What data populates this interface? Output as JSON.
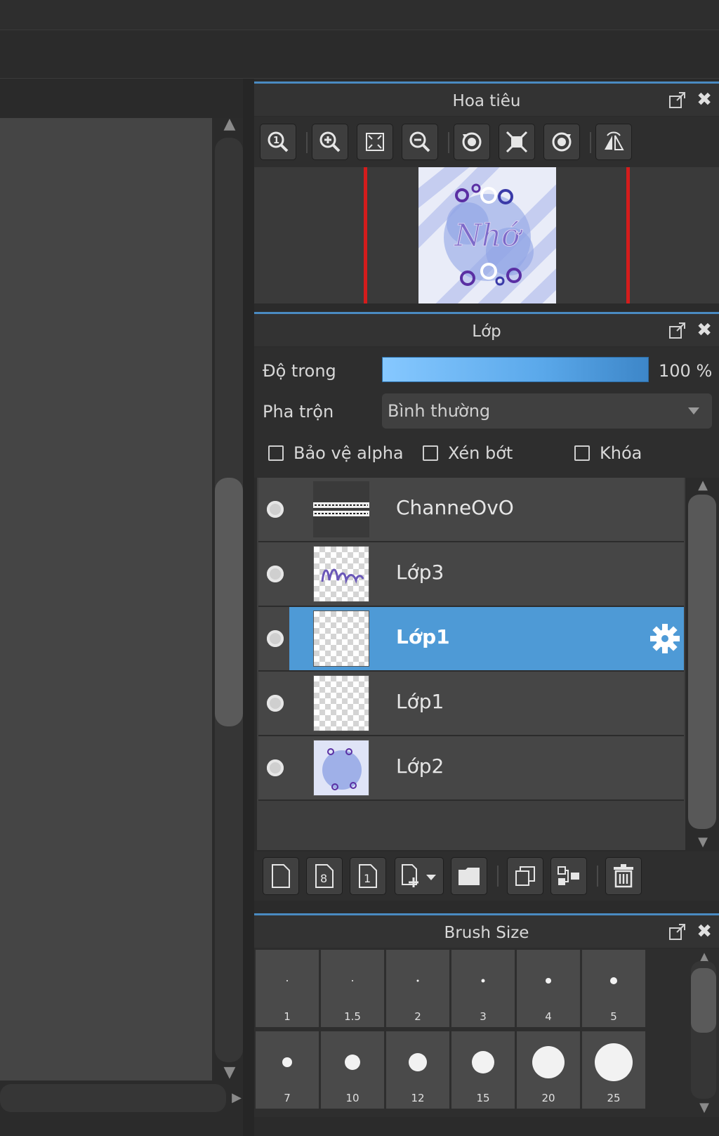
{
  "navigator": {
    "title": "Hoa tiêu",
    "toolbar_icons": [
      "zoom-actual-icon",
      "zoom-in-icon",
      "fit-screen-icon",
      "zoom-out-icon",
      "rotate-left-icon",
      "fit-window-icon",
      "rotate-right-icon",
      "flip-horizontal-icon"
    ],
    "preview_text": "Nhớ"
  },
  "layers": {
    "title": "Lớp",
    "opacity_label": "Độ trong",
    "opacity_value": "100 %",
    "opacity_fraction": 1.0,
    "blend_label": "Pha trộn",
    "blend_value": "Bình thường",
    "checkboxes": [
      {
        "label": "Bảo vệ alpha",
        "checked": false
      },
      {
        "label": "Xén bớt",
        "checked": false
      },
      {
        "label": "Khóa",
        "checked": false
      }
    ],
    "items": [
      {
        "name": "ChanneOvO",
        "selected": false
      },
      {
        "name": "Lớp3",
        "selected": false
      },
      {
        "name": "Lớp1",
        "selected": true
      },
      {
        "name": "Lớp1",
        "selected": false
      },
      {
        "name": "Lớp2",
        "selected": false
      }
    ],
    "buttons": [
      "new-layer-icon",
      "new-8bit-layer-icon",
      "new-1bit-layer-icon",
      "add-layer-dropdown-icon",
      "new-folder-icon",
      "duplicate-layer-icon",
      "merge-down-icon",
      "delete-layer-icon"
    ]
  },
  "brush_size": {
    "title": "Brush Size",
    "sizes": [
      "1",
      "1.5",
      "2",
      "3",
      "4",
      "5",
      "7",
      "10",
      "12",
      "15",
      "20",
      "25"
    ]
  },
  "colors": {
    "accent": "#4a8bc2",
    "selection": "#4e9ad6",
    "red_marker": "#d41c1c"
  }
}
